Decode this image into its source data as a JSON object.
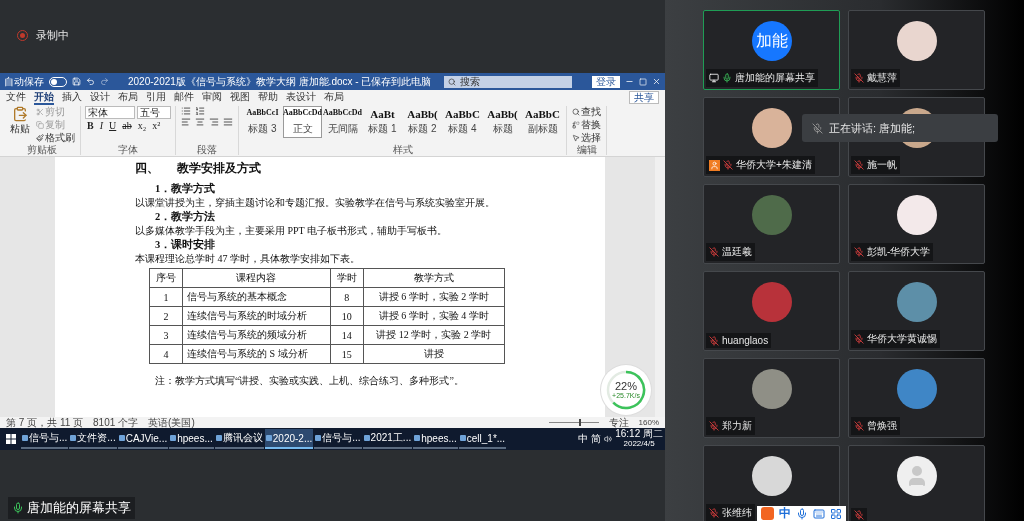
{
  "recording": {
    "label": "录制中",
    "on": true
  },
  "word": {
    "autosave": {
      "label": "自动保存",
      "on": false
    },
    "title": "2020-2021版《信号与系统》教学大纲 唐加能.docx - 已保存到此电脑",
    "search": {
      "placeholder": "搜索"
    },
    "sign_in": "登录",
    "tabs": [
      {
        "label": "文件",
        "selected": false
      },
      {
        "label": "开始",
        "selected": true
      },
      {
        "label": "插入",
        "selected": false
      },
      {
        "label": "设计",
        "selected": false
      },
      {
        "label": "布局",
        "selected": false
      },
      {
        "label": "引用",
        "selected": false
      },
      {
        "label": "邮件",
        "selected": false
      },
      {
        "label": "审阅",
        "selected": false
      },
      {
        "label": "视图",
        "selected": false
      },
      {
        "label": "帮助",
        "selected": false
      },
      {
        "label": "表设计",
        "selected": false
      },
      {
        "label": "布局",
        "selected": false
      }
    ],
    "share": "共享",
    "ribbon": {
      "clipboard": {
        "paste": "粘贴",
        "cut": "剪切",
        "copy": "复制",
        "format_painter": "格式刷",
        "label": "剪贴板"
      },
      "font": {
        "name": "宋体",
        "size": "五号",
        "label": "字体",
        "buttons": [
          {
            "label": "B",
            "kind": "bold"
          },
          {
            "label": "I",
            "kind": "italic"
          },
          {
            "label": "U",
            "kind": "underline"
          },
          {
            "label": "ab",
            "kind": "strike"
          },
          {
            "label": "x₂",
            "kind": "sub"
          },
          {
            "label": "x²",
            "kind": "super"
          }
        ]
      },
      "paragraph": {
        "label": "段落"
      },
      "styles": {
        "label": "样式",
        "items": [
          {
            "sample": "AaBbCcI",
            "name": "标题 3",
            "selected": false
          },
          {
            "sample": "AaBbCcDd",
            "name": "正文",
            "selected": true
          },
          {
            "sample": "AaBbCcDd",
            "name": "无间隔",
            "selected": false
          },
          {
            "sample": "AaBt",
            "name": "标题 1",
            "selected": false
          },
          {
            "sample": "AaBb(",
            "name": "标题 2",
            "selected": false
          },
          {
            "sample": "AaBbC",
            "name": "标题 4",
            "selected": false
          },
          {
            "sample": "AaBb(",
            "name": "标题",
            "selected": false
          },
          {
            "sample": "AaBbC",
            "name": "副标题",
            "selected": false
          }
        ]
      },
      "editing": {
        "find": "查找",
        "replace": "替换",
        "select": "选择",
        "label": "编辑"
      }
    },
    "document": {
      "heading_number": "四、",
      "heading": "教学安排及方式",
      "sections": [
        {
          "title": "1．教学方式",
          "text": "以课堂讲授为主，穿插主题讨论和专题汇报。实验教学在信号与系统实验室开展。"
        },
        {
          "title": "2．教学方法",
          "text": "以多媒体教学手段为主，主要采用 PPT 电子板书形式，辅助手写板书。"
        },
        {
          "title": "3．课时安排",
          "text": "本课程理论总学时 47 学时，具体教学安排如下表。"
        }
      ],
      "table": {
        "columns": [
          "序号",
          "课程内容",
          "学时",
          "教学方式"
        ],
        "rows": [
          [
            "1",
            "信号与系统的基本概念",
            "8",
            "讲授 6 学时，实验 2 学时"
          ],
          [
            "2",
            "连续信号与系统的时域分析",
            "10",
            "讲授 6 学时，实验 4 学时"
          ],
          [
            "3",
            "连续信号与系统的频域分析",
            "14",
            "讲授 12 学时，实验 2 学时"
          ],
          [
            "4",
            "连续信号与系统的 S 域分析",
            "15",
            "讲授"
          ]
        ]
      },
      "note": "注：教学方式填写“讲授、实验或实践、上机、综合练习、多种形式”。"
    },
    "speed_meter": {
      "percent": "22%",
      "rate": "+25.7K/s"
    },
    "status": {
      "page": "第 7 页，共 11 页",
      "words": "8101 个字",
      "language": "英语(美国)",
      "focus": "专注",
      "zoom": "160%",
      "zoom_slider": {
        "level": 0.6
      }
    }
  },
  "taskbar": {
    "apps": [
      {
        "label": "信号与...",
        "selected": false
      },
      {
        "label": "文件资...",
        "selected": false
      },
      {
        "label": "CAJVie...",
        "selected": false
      },
      {
        "label": "hpees...",
        "selected": false
      },
      {
        "label": "腾讯会议",
        "selected": false
      },
      {
        "label": "2020-2...",
        "selected": true
      },
      {
        "label": "信号与...",
        "selected": false
      },
      {
        "label": "2021工...",
        "selected": false
      },
      {
        "label": "hpees...",
        "selected": false
      },
      {
        "label": "cell_1*...",
        "selected": false
      }
    ],
    "tray": {
      "ime": "中",
      "mode": "简",
      "time": "16:12 周二",
      "date": "2022/4/5"
    }
  },
  "share_label": "唐加能的屏幕共享",
  "participants": [
    {
      "name": "唐加能的屏幕共享",
      "kind": "initials",
      "initials": "加能",
      "muted": false,
      "sharing": true,
      "active": true
    },
    {
      "name": "戴慧萍",
      "kind": "photo",
      "color": "#e9d6cf",
      "muted": true,
      "active": false
    },
    {
      "name": "华侨大学+朱建清",
      "kind": "photo",
      "color": "#d9b39a",
      "muted": true,
      "active": false,
      "badge": true
    },
    {
      "name": "施一帆",
      "kind": "photo",
      "color": "#c9a88c",
      "muted": true,
      "active": false
    },
    {
      "name": "温廷羲",
      "kind": "photo",
      "color": "#4f6b4a",
      "muted": true,
      "active": false
    },
    {
      "name": "彭凯-华侨大学",
      "kind": "photo",
      "color": "#f3e9ea",
      "muted": true,
      "active": false
    },
    {
      "name": "huanglaos",
      "kind": "photo",
      "color": "#b8323a",
      "muted": true,
      "active": false
    },
    {
      "name": "华侨大学黄诚惕",
      "kind": "photo",
      "color": "#5d8fa8",
      "muted": true,
      "active": false
    },
    {
      "name": "郑力新",
      "kind": "photo",
      "color": "#8f8f86",
      "muted": true,
      "active": false
    },
    {
      "name": "曾焕强",
      "kind": "photo",
      "color": "#3f86c6",
      "muted": true,
      "active": false
    },
    {
      "name": "张维纬",
      "kind": "photo",
      "color": "#d8d8d8",
      "muted": true,
      "active": false
    },
    {
      "kind": "placeholder",
      "muted": true,
      "active": false
    }
  ],
  "speaking_toast": {
    "text": "正在讲话: 唐加能;"
  },
  "ime_bar": {
    "mode": "中"
  }
}
